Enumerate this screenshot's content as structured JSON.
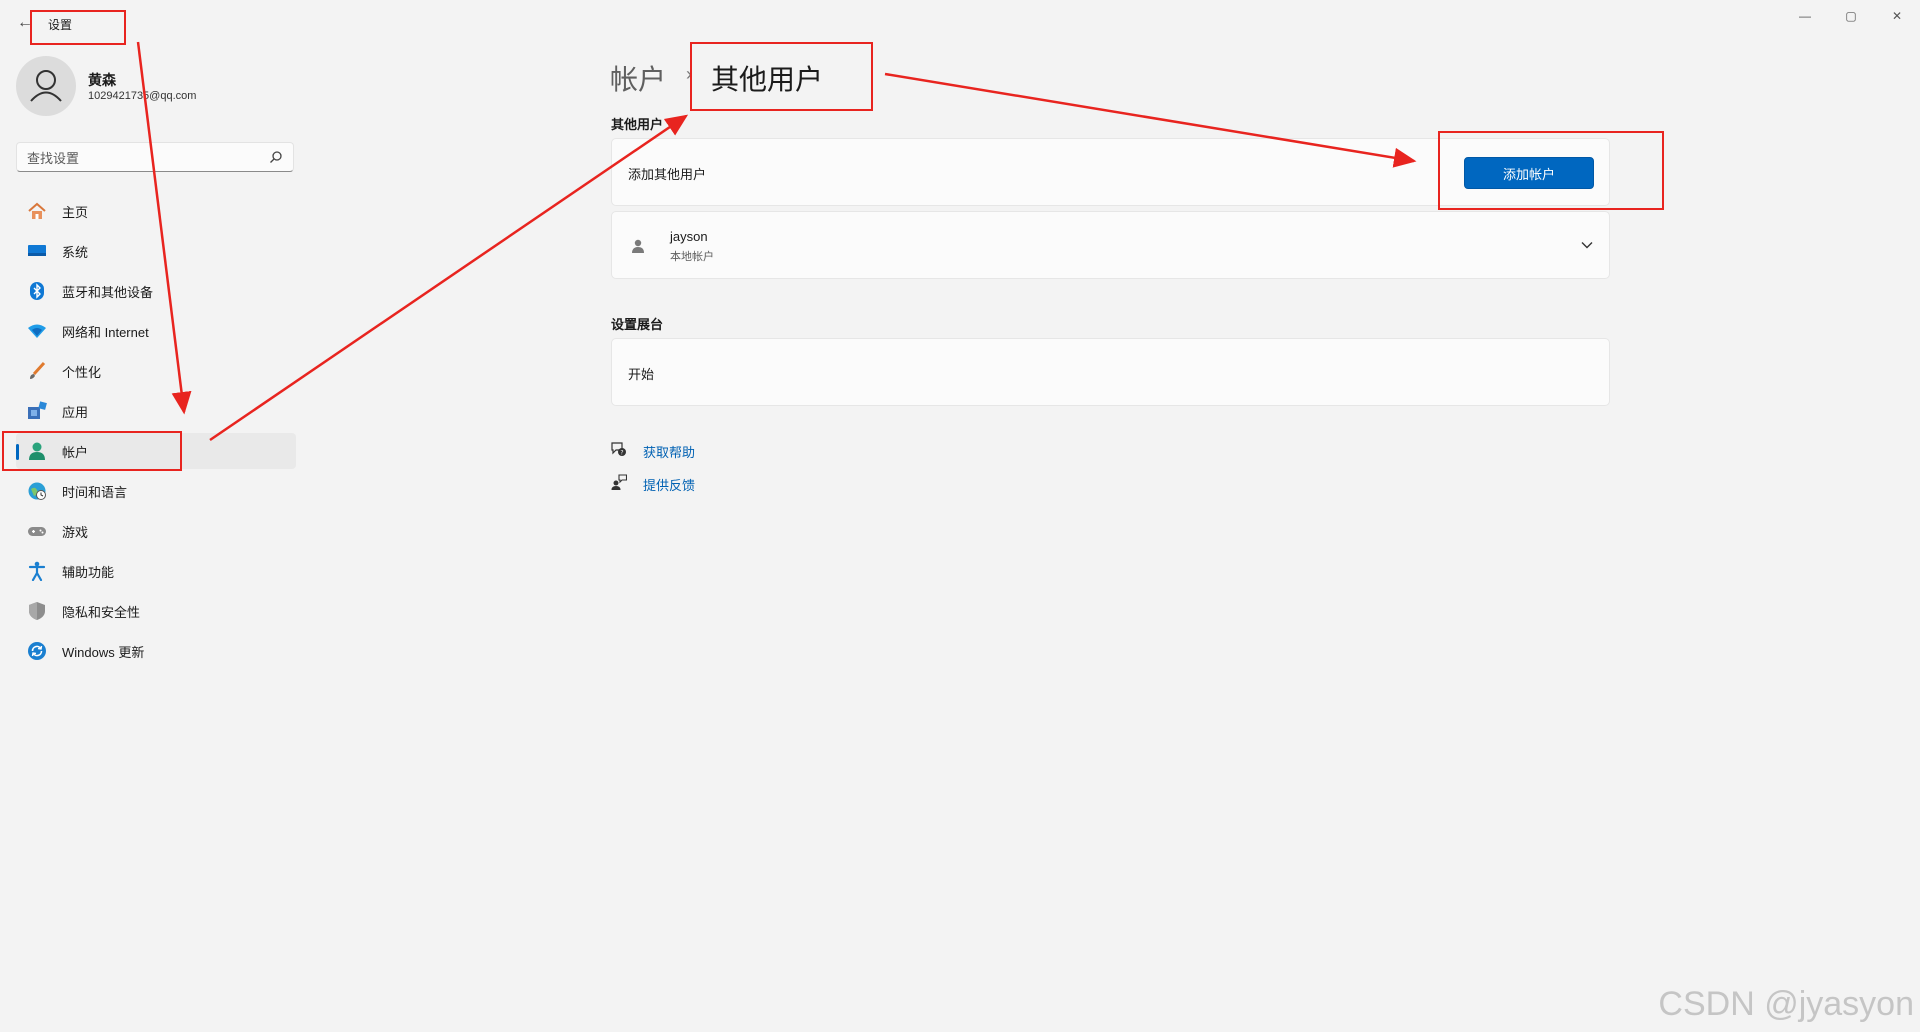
{
  "window": {
    "title": "设置",
    "controls": {
      "minimize": "—",
      "maximize": "▢",
      "close": "✕"
    }
  },
  "user": {
    "name": "黄森",
    "email": "1029421735@qq.com"
  },
  "search": {
    "placeholder": "查找设置"
  },
  "sidebar": {
    "items": [
      {
        "label": "主页",
        "icon": "home-icon"
      },
      {
        "label": "系统",
        "icon": "system-icon"
      },
      {
        "label": "蓝牙和其他设备",
        "icon": "bluetooth-icon"
      },
      {
        "label": "网络和 Internet",
        "icon": "wifi-icon"
      },
      {
        "label": "个性化",
        "icon": "brush-icon"
      },
      {
        "label": "应用",
        "icon": "apps-icon"
      },
      {
        "label": "帐户",
        "icon": "account-icon",
        "active": true
      },
      {
        "label": "时间和语言",
        "icon": "globe-clock-icon"
      },
      {
        "label": "游戏",
        "icon": "gamepad-icon"
      },
      {
        "label": "辅助功能",
        "icon": "accessibility-icon"
      },
      {
        "label": "隐私和安全性",
        "icon": "shield-icon"
      },
      {
        "label": "Windows 更新",
        "icon": "update-icon"
      }
    ]
  },
  "breadcrumb": {
    "parent": "帐户",
    "separator": "›",
    "current": "其他用户"
  },
  "other_users": {
    "heading": "其他用户",
    "add_label": "添加其他用户",
    "add_button": "添加帐户",
    "accounts": [
      {
        "name": "jayson",
        "type": "本地帐户"
      }
    ]
  },
  "kiosk": {
    "heading": "设置展台",
    "start_label": "开始"
  },
  "links": {
    "help": "获取帮助",
    "feedback": "提供反馈"
  },
  "watermark": "CSDN @jyasyon",
  "colors": {
    "accent": "#0067c0",
    "annotation": "#e8241f",
    "background": "#f3f3f3"
  }
}
